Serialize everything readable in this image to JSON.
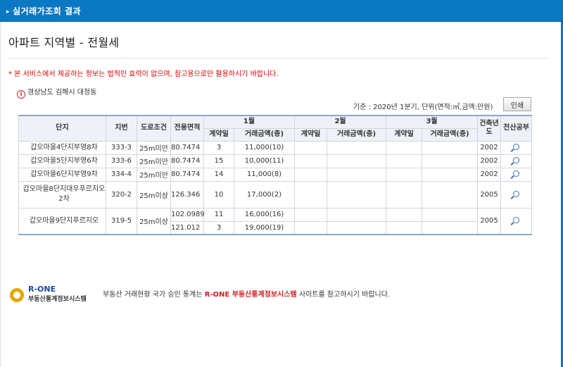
{
  "header": {
    "title": "실거래가조회 결과",
    "arrow": "▸"
  },
  "page_title": "아파트 지역별 - 전월세",
  "notice": "* 본 서비스에서 제공하는 정보는 법적인 효력이 없으며, 참고용으로만 활용하시기 바랍니다.",
  "region": "경상남도 김해시 대청동",
  "info_icon_glyph": "i",
  "standard_text": "기준 : 2020년 1분기, 단위(면적:㎡,금액:만원)",
  "print_button": "인쇄",
  "table": {
    "headers": {
      "complex": "단지",
      "lot": "지번",
      "road": "도로조건",
      "area": "전용면적",
      "month1": "1월",
      "month2": "2월",
      "month3": "3월",
      "contract_day": "계약일",
      "amount": "거래금액(층)",
      "year": "건축년도",
      "register": "전산공부"
    },
    "rows": [
      {
        "name": "갑오마을4단지부영8차",
        "lot": "333-3",
        "road": "25m미만",
        "area": "80.7474",
        "day": "3",
        "amount": "11,000",
        "floor": "(10)",
        "year": "2002"
      },
      {
        "name": "갑오마을5단지부영6차",
        "lot": "333-6",
        "road": "25m미만",
        "area": "80.7474",
        "day": "15",
        "amount": "10,000",
        "floor": "(11)",
        "year": "2002"
      },
      {
        "name": "갑오마을6단지부영9차",
        "lot": "334-4",
        "road": "25m미만",
        "area": "80.7474",
        "day": "14",
        "amount": "11,000",
        "floor": "(8)",
        "year": "2002"
      },
      {
        "name": "갑오마을8단지대우푸르지오2차",
        "lot": "320-2",
        "road": "25m이상",
        "area": "126.346",
        "day": "10",
        "amount": "17,000",
        "floor": "(2)",
        "year": "2005"
      },
      {
        "name": "갑오마을9단지푸르지오",
        "lot": "319-5",
        "road": "25m이상",
        "area": "102.0989",
        "day": "11",
        "amount": "16,000",
        "floor": "(16)",
        "year": "2005",
        "area2": "121.012",
        "day2": "3",
        "amount2": "19,000",
        "floor2": "(19)"
      }
    ]
  },
  "rone": {
    "logo_line1": "R-ONE",
    "logo_line2": "부동산통계정보시스템",
    "desc_before": "부동산 거래현황 국가 승인 통계는",
    "desc_highlight": "R-ONE 부동산통계정보시스템",
    "desc_after": "사이트를 참고하시기 바랍니다."
  }
}
